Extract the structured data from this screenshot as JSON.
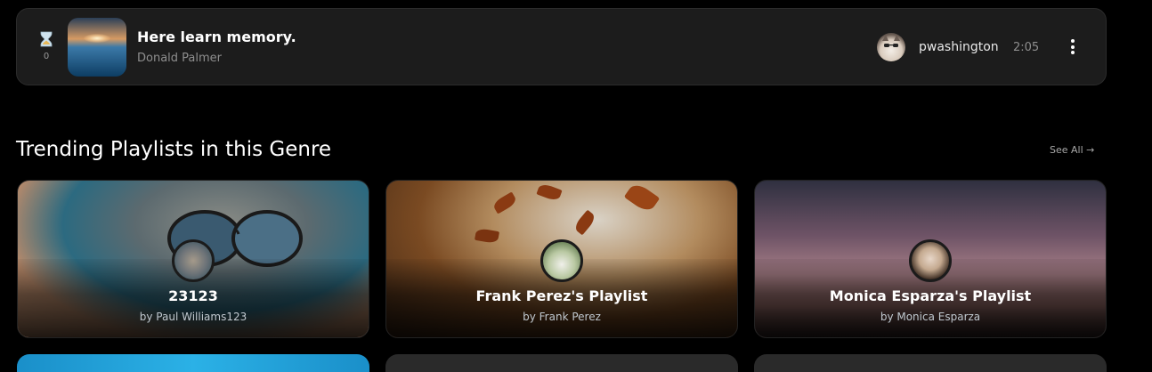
{
  "now_playing": {
    "rank": "0",
    "title": "Here learn memory.",
    "artist": "Donald Palmer",
    "username": "pwashington",
    "duration": "2:05"
  },
  "section": {
    "title": "Trending Playlists in this Genre",
    "see_all": "See All →"
  },
  "playlists": [
    {
      "name": "23123",
      "by": "by Paul Williams123"
    },
    {
      "name": "Frank Perez's Playlist",
      "by": "by Frank Perez"
    },
    {
      "name": "Monica Esparza's Playlist",
      "by": "by Monica Esparza"
    }
  ],
  "colors": {
    "background": "#000000",
    "panel": "#1c1c1c",
    "muted_text": "#8e8e8e"
  }
}
